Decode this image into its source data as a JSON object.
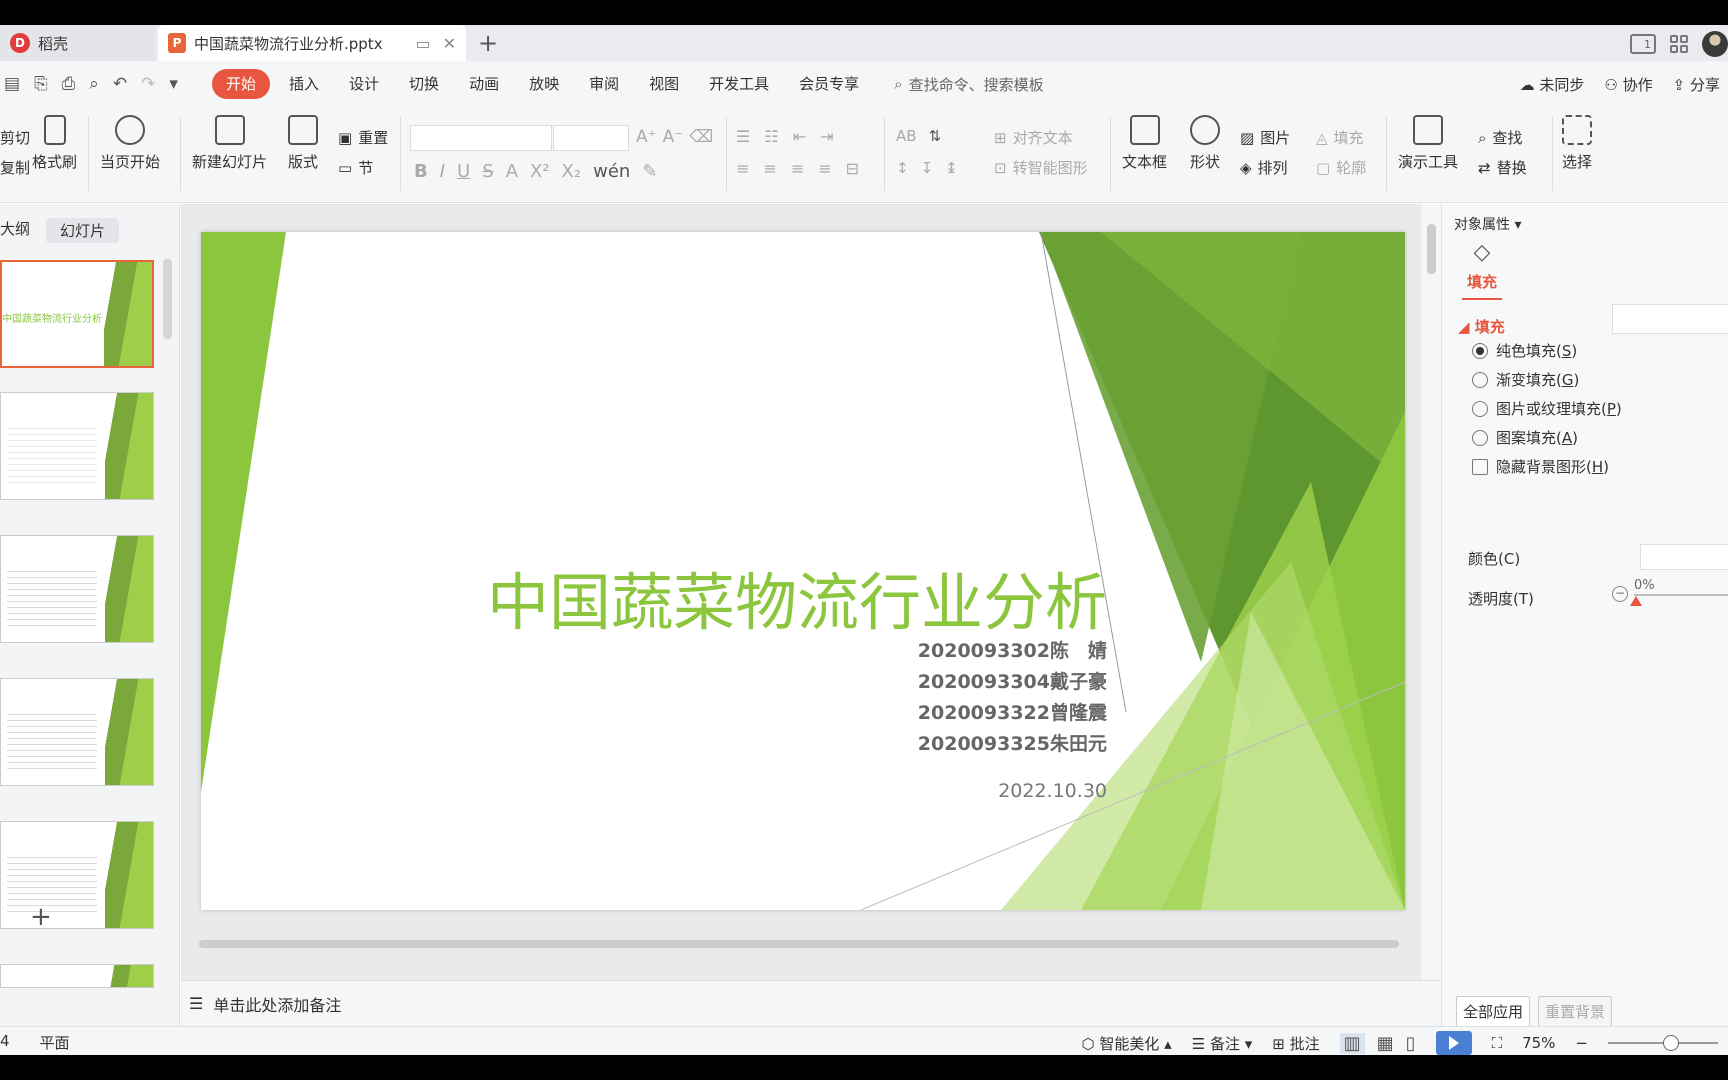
{
  "tabs": {
    "app_label": "稻壳",
    "doc_label": "中国蔬菜物流行业分析.pptx"
  },
  "menu": {
    "items": [
      "开始",
      "插入",
      "设计",
      "切换",
      "动画",
      "放映",
      "审阅",
      "视图",
      "开发工具",
      "会员专享"
    ],
    "search": "查找命令、搜索模板",
    "sync": "未同步",
    "collab": "协作",
    "share": "分享"
  },
  "ribbon": {
    "cut": "剪切",
    "copy": "复制",
    "format_painter": "格式刷",
    "from_current": "当页开始",
    "new_slide": "新建幻灯片",
    "layout": "版式",
    "reset": "重置",
    "section": "节",
    "align_text": "对齐文本",
    "smart_art": "转智能图形",
    "textbox": "文本框",
    "shape": "形状",
    "picture": "图片",
    "arrange": "排列",
    "fill": "填充",
    "outline": "轮廓",
    "present_tools": "演示工具",
    "find": "查找",
    "replace": "替换",
    "select": "选择"
  },
  "left_panel": {
    "tab_outline": "大纲",
    "tab_slides": "幻灯片",
    "thumb1_title": "中国蔬菜物流行业分析"
  },
  "slide": {
    "title": "中国蔬菜物流行业分析",
    "names": [
      "2020093302陈　婧",
      "2020093304戴子豪",
      "2020093322曾隆震",
      "2020093325朱田元"
    ],
    "date": "2022.10.30"
  },
  "notes_placeholder": "单击此处添加备注",
  "right_panel": {
    "header": "对象属性",
    "tab": "填充",
    "section": "填充",
    "options": [
      {
        "label": "纯色填充(",
        "key": "S",
        "end": ")",
        "checked": true
      },
      {
        "label": "渐变填充(",
        "key": "G",
        "end": ")",
        "checked": false
      },
      {
        "label": "图片或纹理填充(",
        "key": "P",
        "end": ")",
        "checked": false
      },
      {
        "label": "图案填充(",
        "key": "A",
        "end": ")",
        "checked": false
      }
    ],
    "hide_bg_label": "隐藏背景图形(",
    "hide_bg_key": "H",
    "hide_bg_end": ")",
    "color_label": "颜色(C)",
    "transparency_label": "透明度(T)",
    "transparency_value": "0%",
    "apply_all": "全部应用",
    "reset_bg": "重置背景"
  },
  "status": {
    "page": "4",
    "view": "平面",
    "smart": "智能美化",
    "notes": "备注",
    "comment": "批注",
    "zoom": "75%"
  },
  "colors": {
    "accent": "#e8563f",
    "slide_green": "#8cc63f",
    "play_blue": "#4a7fd4"
  }
}
